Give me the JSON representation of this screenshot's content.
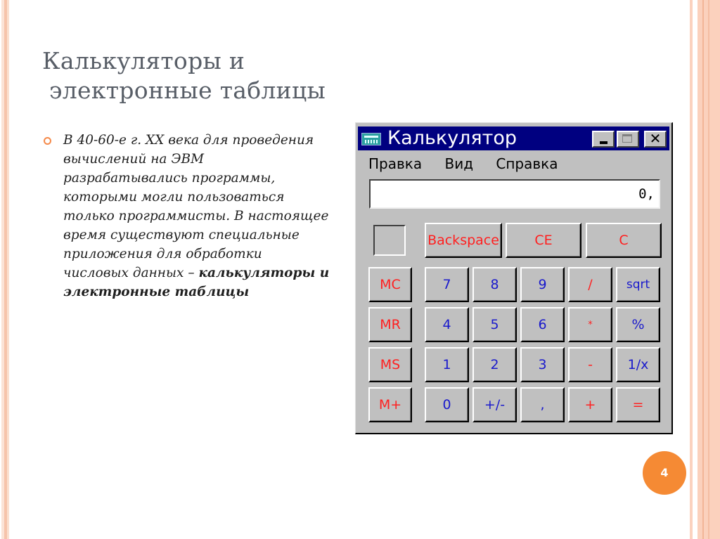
{
  "slide": {
    "title_line1": "Калькуляторы и",
    "title_line2": "электронные таблицы",
    "bullet_text": "В 40-60-е г. XX века для проведения вычислений на ЭВМ разрабатывались программы, которыми могли пользоваться только программисты. В настоящее время существуют специальные приложения для обработки числовых данных –",
    "bullet_bold": "калькуляторы и электронные таблицы",
    "page_number": "4",
    "accent_color": "#f58a34"
  },
  "calculator": {
    "window_title": "Калькулятор",
    "title_buttons": {
      "minimize": "minimize",
      "maximize": "maximize",
      "close": "✕"
    },
    "menu": [
      "Правка",
      "Вид",
      "Справка"
    ],
    "display_value": "0,",
    "top_row": [
      "Backspace",
      "CE",
      "C"
    ],
    "memory_keys": [
      "MC",
      "MR",
      "MS",
      "M+"
    ],
    "keypad": [
      [
        "7",
        "8",
        "9",
        "/",
        "sqrt"
      ],
      [
        "4",
        "5",
        "6",
        "*",
        "%"
      ],
      [
        "1",
        "2",
        "3",
        "-",
        "1/x"
      ],
      [
        "0",
        "+/-",
        ",",
        "+",
        "="
      ]
    ],
    "colors": {
      "titlebar": "#000080",
      "face": "#c0c0c0",
      "red_label": "#ff2020",
      "blue_label": "#1a1acc"
    }
  }
}
